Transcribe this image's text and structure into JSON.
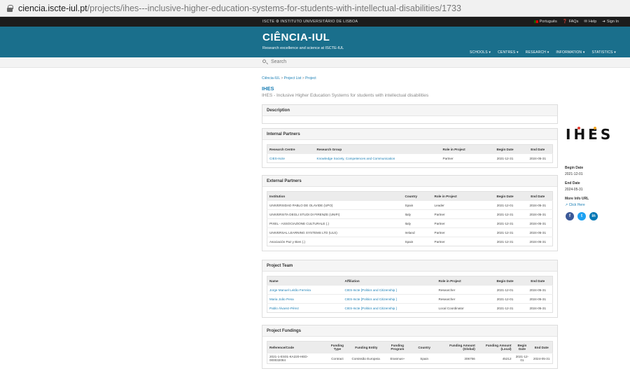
{
  "browser": {
    "host": "ciencia.iscte-iul.pt",
    "path": "/projects/ihes---inclusive-higher-education-systems-for-students-with-intellectual-disabilities/1733"
  },
  "topbar": {
    "brand": "ISCTE ⚙ INSTITUTO UNIVERSITÁRIO DE LISBOA",
    "lang": "Português",
    "faqs": "FAQs",
    "help": "Help",
    "signin": "Sign In"
  },
  "header": {
    "logo": "CIÊNCIA-IUL",
    "tagline": "Research excellence and science at ISCTE-IUL",
    "nav": [
      "SCHOOLS ▾",
      "CENTRES ▾",
      "RESEARCH ▾",
      "INFORMATION ▾",
      "STATISTICS ▾"
    ]
  },
  "search": {
    "placeholder": "Search"
  },
  "breadcrumb": {
    "home": "Ciência-IUL",
    "sep": " > ",
    "list": "Project List",
    "current": "Project"
  },
  "project": {
    "acronym": "IHES",
    "title": "IHES - Inclusive Higher Education Systems for students with intellectual disabilities"
  },
  "sections": {
    "description": "Description",
    "internal": "Internal Partners",
    "external": "External Partners",
    "team": "Project Team",
    "fundings": "Project Fundings"
  },
  "internal": {
    "headers": [
      "Research Centre",
      "Research Group",
      "Role in Project",
      "Begin Date",
      "End Date"
    ],
    "rows": [
      [
        "CIES-Iscte",
        "Knowledge Society, Competences and Communication",
        "Partner",
        "2021-12-31",
        "2024-05-31"
      ]
    ]
  },
  "external": {
    "headers": [
      "Institution",
      "Country",
      "Role in Project",
      "Begin Date",
      "End Date"
    ],
    "rows": [
      [
        "UNIVERSIDAD PABLO DE OLAVIDE (UPO)",
        "Spain",
        "Leader",
        "2021-12-01",
        "2024-05-31"
      ],
      [
        "UNIVERSITA DEGLI STUDI DI FIRENZE (UNIFI)",
        "Italy",
        "Partner",
        "2021-12-31",
        "2024-05-31"
      ],
      [
        "PIXEL - ASSOCIAZIONE CULTURALE (.)",
        "Italy",
        "Partner",
        "2021-12-31",
        "2024-05-31"
      ],
      [
        "UNIVERSAL LEARNING SYSTEMS LTD (ULS)",
        "Ireland",
        "Partner",
        "2021-12-31",
        "2024-05-31"
      ],
      [
        "Asociación Paz y Bien (.)",
        "Spain",
        "Partner",
        "2021-12-31",
        "2024-05-31"
      ]
    ]
  },
  "team": {
    "headers": [
      "Name",
      "Affiliation",
      "Role in Project",
      "Begin Date",
      "End Date"
    ],
    "rows": [
      [
        "Jorge Manuel Leitão Ferreira",
        "CIES-Iscte [Politics and Citizenship ]",
        "Researcher",
        "2021-12-01",
        "2024-05-31"
      ],
      [
        "Maria João Pena",
        "CIES-Iscte [Politics and Citizenship ]",
        "Researcher",
        "2021-12-01",
        "2024-05-31"
      ],
      [
        "Pablo Álvarez-Pérez",
        "CIES-Iscte [Politics and Citizenship ]",
        "Local Coordinator",
        "2021-12-31",
        "2024-05-31"
      ]
    ]
  },
  "fundings": {
    "headers": [
      "Reference/Code",
      "Funding Type",
      "Funding Entity",
      "Funding Program",
      "Country",
      "Funding Amount (Global)",
      "Funding Amount (Local)",
      "Begin Date",
      "End Date"
    ],
    "rows": [
      [
        "2021-1-ES01-KA220-HED-000032084",
        "Contract",
        "Comissão Europeia",
        "Erasmus+",
        "Spain",
        "306756",
        "45212",
        "2021-12-01",
        "2024-05-31"
      ]
    ]
  },
  "sidebar": {
    "logo": "IHES",
    "begin_label": "Begin Date",
    "begin": "2021-12-01",
    "end_label": "End Date",
    "end": "2024-05-31",
    "info_label": "More Info URL",
    "info_link": "Click Here"
  },
  "colors": {
    "header": "#1a6f8c",
    "link": "#1a7fb5",
    "facebook": "#3b5998",
    "twitter": "#1da1f2",
    "linkedin": "#0077b5"
  }
}
